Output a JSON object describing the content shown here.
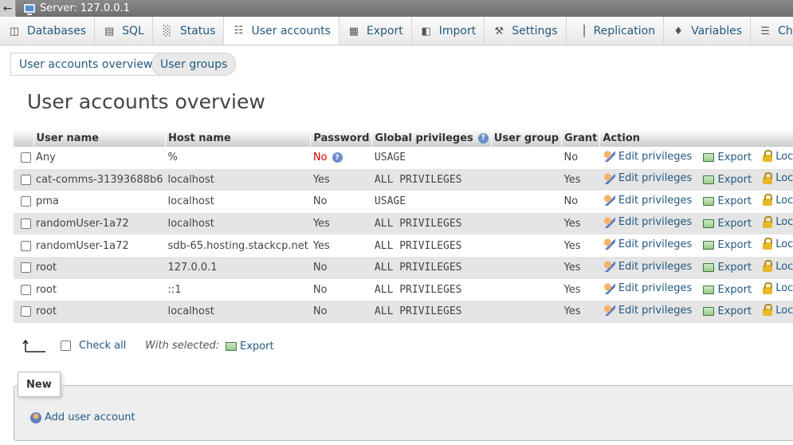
{
  "server": {
    "title": "Server: 127.0.0.1"
  },
  "tabs": [
    {
      "label": "Databases",
      "icon": "database-icon"
    },
    {
      "label": "SQL",
      "icon": "sql-icon"
    },
    {
      "label": "Status",
      "icon": "status-icon"
    },
    {
      "label": "User accounts",
      "icon": "users-icon"
    },
    {
      "label": "Export",
      "icon": "export-icon"
    },
    {
      "label": "Import",
      "icon": "import-icon"
    },
    {
      "label": "Settings",
      "icon": "wrench-icon"
    },
    {
      "label": "Replication",
      "icon": "replication-icon"
    },
    {
      "label": "Variables",
      "icon": "variables-icon"
    },
    {
      "label": "Chars",
      "icon": "charset-icon"
    }
  ],
  "subtabs": {
    "overview": "User accounts overview",
    "groups": "User groups"
  },
  "page_title": "User accounts overview",
  "table": {
    "headers": {
      "user": "User name",
      "host": "Host name",
      "password": "Password",
      "privs": "Global privileges",
      "group": "User group",
      "grant": "Grant",
      "action": "Action"
    },
    "actions": {
      "edit": "Edit privileges",
      "export": "Export",
      "lock": "Lock"
    },
    "rows": [
      {
        "user": "Any",
        "host": "%",
        "password": "No",
        "privs": "USAGE",
        "group": "",
        "grant": "No"
      },
      {
        "user": "cat-comms-31393688b6",
        "host": "localhost",
        "password": "Yes",
        "privs": "ALL PRIVILEGES",
        "group": "",
        "grant": "Yes"
      },
      {
        "user": "pma",
        "host": "localhost",
        "password": "No",
        "privs": "USAGE",
        "group": "",
        "grant": "No"
      },
      {
        "user": "randomUser-1a72",
        "host": "localhost",
        "password": "Yes",
        "privs": "ALL PRIVILEGES",
        "group": "",
        "grant": "Yes"
      },
      {
        "user": "randomUser-1a72",
        "host": "sdb-65.hosting.stackcp.net",
        "password": "Yes",
        "privs": "ALL PRIVILEGES",
        "group": "",
        "grant": "Yes"
      },
      {
        "user": "root",
        "host": "127.0.0.1",
        "password": "No",
        "privs": "ALL PRIVILEGES",
        "group": "",
        "grant": "Yes"
      },
      {
        "user": "root",
        "host": "::1",
        "password": "No",
        "privs": "ALL PRIVILEGES",
        "group": "",
        "grant": "Yes"
      },
      {
        "user": "root",
        "host": "localhost",
        "password": "No",
        "privs": "ALL PRIVILEGES",
        "group": "",
        "grant": "Yes"
      }
    ]
  },
  "bulk": {
    "check_all": "Check all",
    "with_selected": "With selected:",
    "export": "Export"
  },
  "new_section": {
    "legend": "New",
    "add_user": "Add user account"
  },
  "colors": {
    "link": "#235a81",
    "no_password": "#dd0000",
    "row_alt": "#e5e5e5"
  }
}
